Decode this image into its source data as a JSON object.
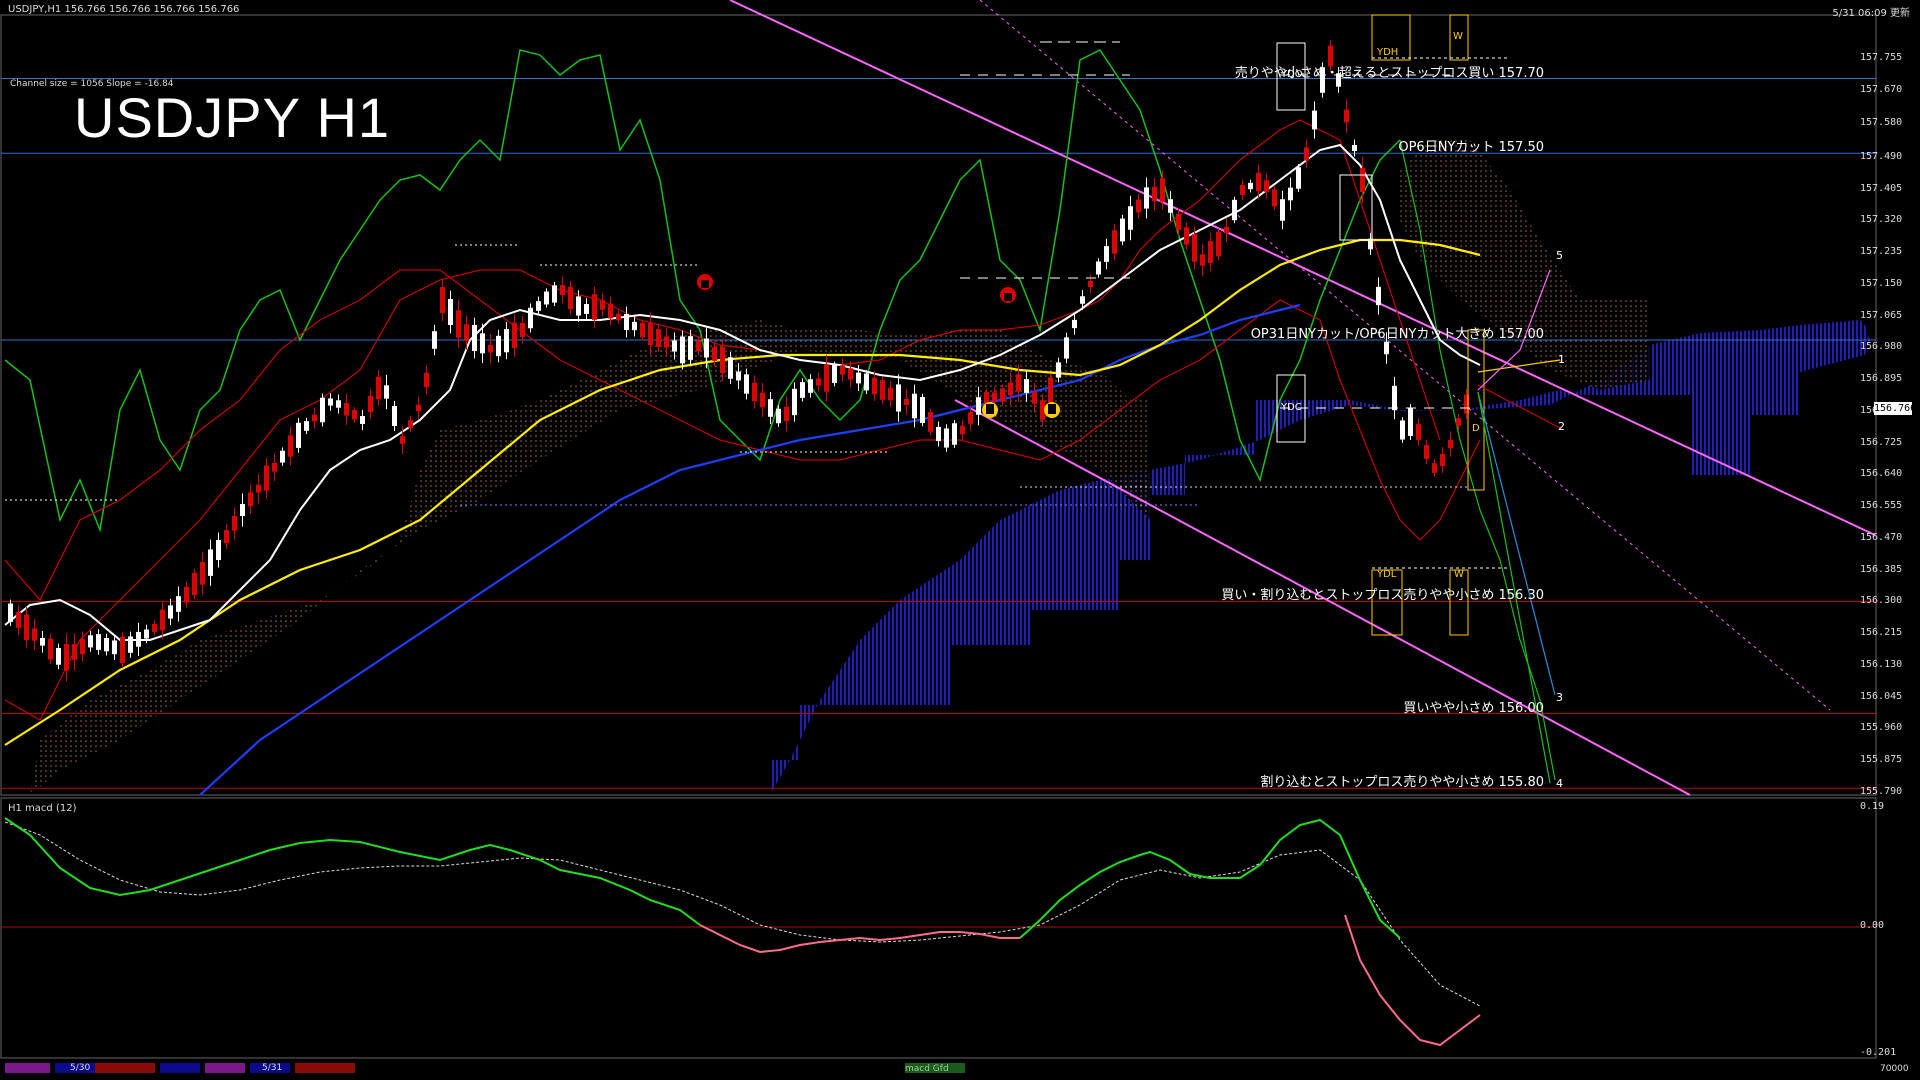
{
  "header": {
    "symbol_info": "USDJPY,H1  156.766 156.766 156.766 156.766",
    "datetime": "5/31 06:09 更新",
    "channel_info": "Channel size = 1056 Slope = -16.84",
    "title": "USDJPY H1"
  },
  "levels": [
    {
      "label": "売りやや小さめ・超えるとストップロス買い 157.70",
      "price": 157.7,
      "color": "#2f6fd6"
    },
    {
      "label": "OP6日NYカット 157.50",
      "price": 157.5,
      "color": "#2f6fd6"
    },
    {
      "label": "OP31日NYカット/OP6日NYカット大きめ 157.00",
      "price": 157.0,
      "color": "#2f6fd6"
    },
    {
      "label": "買い・割り込むとストップロス売りやや小さめ 156.30",
      "price": 156.3,
      "color": "#c00000"
    },
    {
      "label": "買いやや小さめ 156.00",
      "price": 156.0,
      "color": "#c00000"
    },
    {
      "label": "割り込むとストップロス売りやや小さめ 155.80",
      "price": 155.8,
      "color": "#c00000"
    }
  ],
  "price_axis": {
    "ticks": [
      "157.755",
      "157.670",
      "157.580",
      "157.490",
      "157.405",
      "157.320",
      "157.235",
      "157.150",
      "157.065",
      "156.980",
      "156.895",
      "156.810",
      "156.725",
      "156.640",
      "156.555",
      "156.470",
      "156.385",
      "156.300",
      "156.215",
      "156.130",
      "156.045",
      "155.960",
      "155.875",
      "155.790"
    ],
    "current_price": "156.766"
  },
  "markers": {
    "ydh": "YDH",
    "ydo": "YDO",
    "ydc": "YDC",
    "ydl": "YDL",
    "w_top": "W",
    "w_bottom": "W",
    "d": "D"
  },
  "projection_labels": [
    "1",
    "2",
    "3",
    "4",
    "5"
  ],
  "macd": {
    "title": "H1  macd (12)",
    "ticks": [
      "0.19",
      "0.00",
      "-0.201"
    ]
  },
  "bottom_bar": {
    "date_labels": [
      "5/30",
      "5/31"
    ],
    "indicator_label": "macd Gfd",
    "right_value": "70000"
  },
  "colors": {
    "background": "#000000",
    "bull_candle": "#ffffff",
    "bear_candle": "#e00000",
    "kumo_fill": "#1a1aa0",
    "channel_line": "#ff66ff",
    "ma_fast": "#ffffff",
    "ma_mid": "#ffee00",
    "ma_slow": "#1f3fff",
    "chikou": "#19c019",
    "macd_up": "#22dd22",
    "macd_down": "#ff6b8a"
  }
}
